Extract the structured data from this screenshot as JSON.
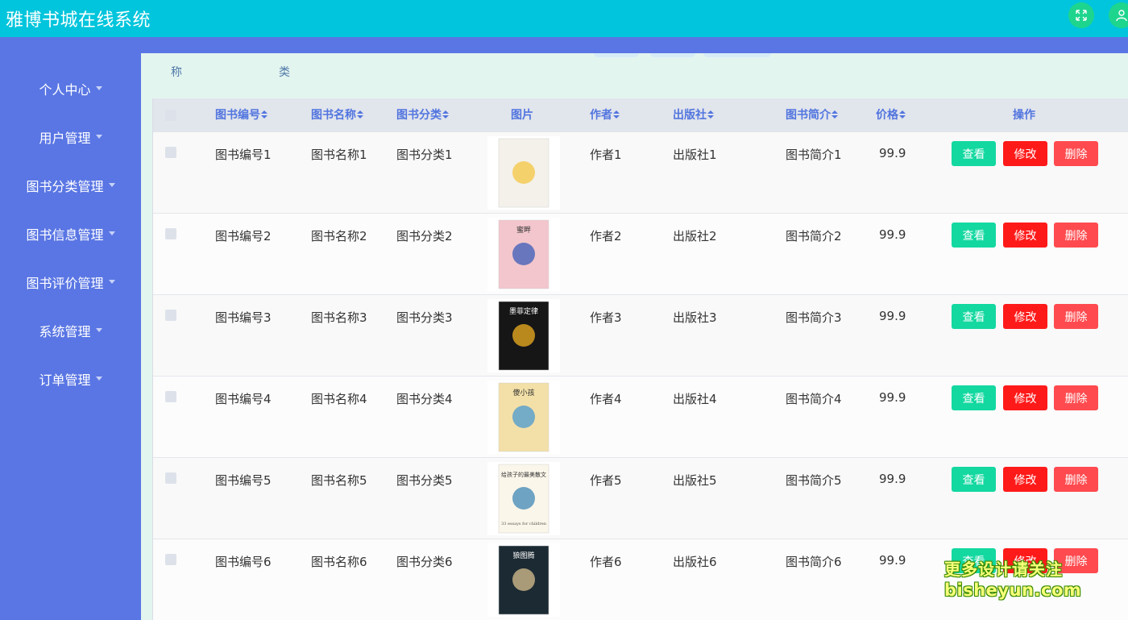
{
  "app": {
    "title": "雅博书城在线系统",
    "accent": "#00c5dc",
    "sidebar_color": "#5a76e4"
  },
  "header": {
    "fullscreen_icon": "expand-icon",
    "user_icon": "user-icon"
  },
  "sidebar": {
    "items": [
      {
        "label": "个人中心"
      },
      {
        "label": "用户管理"
      },
      {
        "label": "图书分类管理"
      },
      {
        "label": "图书信息管理"
      },
      {
        "label": "图书评价管理"
      },
      {
        "label": "系统管理"
      },
      {
        "label": "订单管理"
      }
    ]
  },
  "search": {
    "label_name": "称",
    "label_category": "类"
  },
  "table": {
    "columns": {
      "code": "图书编号",
      "name": "图书名称",
      "category": "图书分类",
      "image": "图片",
      "author": "作者",
      "publisher": "出版社",
      "intro": "图书简介",
      "price": "价格",
      "actions": "操作"
    },
    "actions": {
      "view": "查看",
      "edit": "修改",
      "delete": "删除"
    },
    "rows": [
      {
        "code": "图书编号1",
        "name": "图书名称1",
        "category": "图书分类1",
        "author": "作者1",
        "publisher": "出版社1",
        "intro": "图书简介1",
        "price": "99.9",
        "cover": {
          "title": "",
          "subtitle": "",
          "bg": "#f4f1ea",
          "accent": "#f5c542"
        }
      },
      {
        "code": "图书编号2",
        "name": "图书名称2",
        "category": "图书分类2",
        "author": "作者2",
        "publisher": "出版社2",
        "intro": "图书简介2",
        "price": "99.9",
        "cover": {
          "title": "蜜畔",
          "subtitle": "",
          "bg": "#f2c6cc",
          "accent": "#3a5bb8"
        }
      },
      {
        "code": "图书编号3",
        "name": "图书名称3",
        "category": "图书分类3",
        "author": "作者3",
        "publisher": "出版社3",
        "intro": "图书简介3",
        "price": "99.9",
        "cover": {
          "title": "墨菲定律",
          "subtitle": "",
          "bg": "#161616",
          "accent": "#f0b020"
        }
      },
      {
        "code": "图书编号4",
        "name": "图书名称4",
        "category": "图书分类4",
        "author": "作者4",
        "publisher": "出版社4",
        "intro": "图书简介4",
        "price": "99.9",
        "cover": {
          "title": "傻小孩",
          "subtitle": "",
          "bg": "#f3e0a8",
          "accent": "#4a9ad0"
        }
      },
      {
        "code": "图书编号5",
        "name": "图书名称5",
        "category": "图书分类5",
        "author": "作者5",
        "publisher": "出版社5",
        "intro": "图书简介5",
        "price": "99.9",
        "cover": {
          "title": "给孩子的最美散文",
          "subtitle": "33 essays for children",
          "bg": "#fbf6ea",
          "accent": "#3f87b5"
        }
      },
      {
        "code": "图书编号6",
        "name": "图书名称6",
        "category": "图书分类6",
        "author": "作者6",
        "publisher": "出版社6",
        "intro": "图书简介6",
        "price": "99.9",
        "cover": {
          "title": "狼图腾",
          "subtitle": "",
          "bg": "#1c2a33",
          "accent": "#d8c090"
        }
      }
    ]
  },
  "watermark": {
    "line1": "更多设计请关注",
    "line2": "bisheyun.com"
  }
}
